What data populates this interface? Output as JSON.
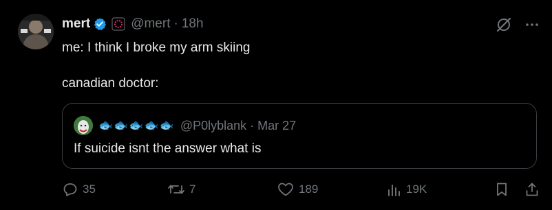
{
  "tweet": {
    "author": {
      "display_name": "mert",
      "handle": "@mert",
      "time": "18h",
      "avatar_icon": "profile-avatar",
      "verified_color": "#1d9bf0",
      "affiliate_color": "#e0245e"
    },
    "sep": "·",
    "text": "me: I think I broke my arm skiing\n\ncanadian doctor:",
    "quote": {
      "display_name": "🐟🐟🐟🐟🐟",
      "handle": "@P0lyblank",
      "time": "Mar 27",
      "text": "If suicide isnt the answer what is"
    },
    "actions": {
      "reply_count": "35",
      "retweet_count": "7",
      "like_count": "189",
      "view_count": "19K"
    }
  }
}
